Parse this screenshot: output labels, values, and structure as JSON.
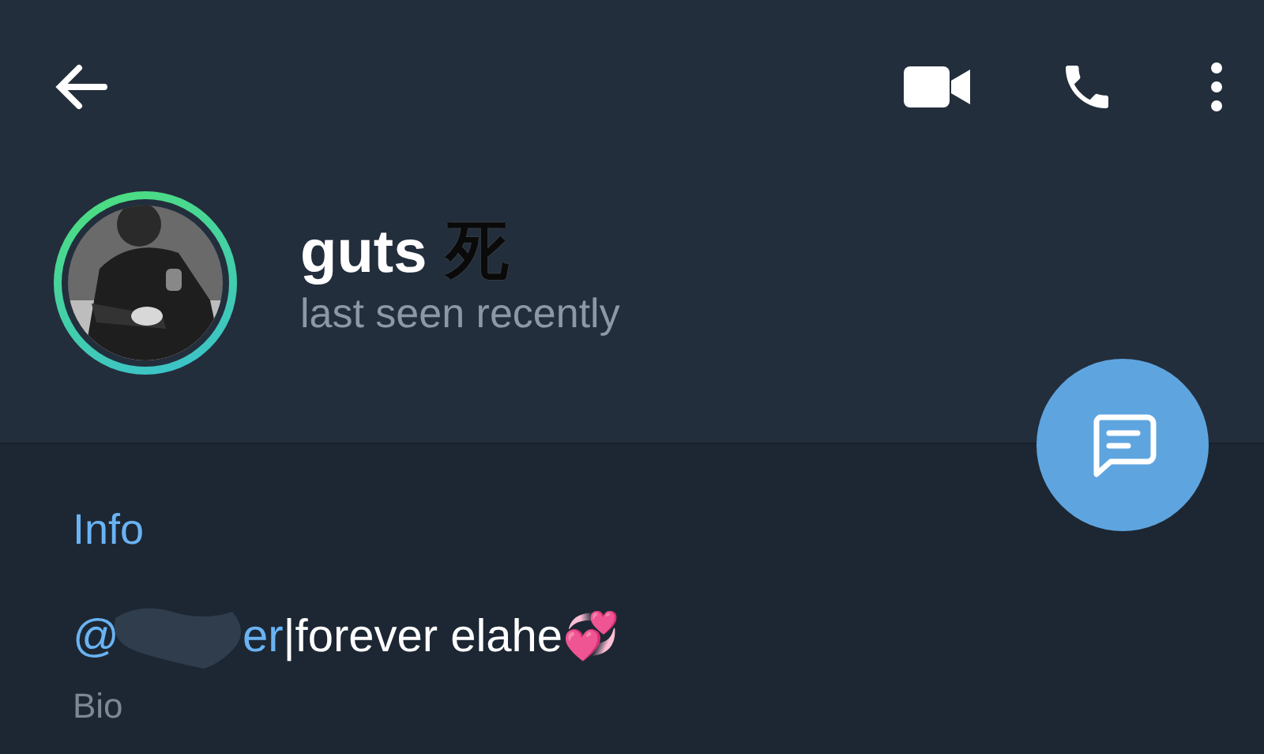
{
  "header": {
    "name": "guts",
    "name_symbol": "死",
    "status": "last seen recently"
  },
  "info": {
    "heading": "Info",
    "bio": {
      "mention_start": "@",
      "mention_end": "er",
      "text": "|forever elahe💞",
      "label": "Bio"
    }
  }
}
